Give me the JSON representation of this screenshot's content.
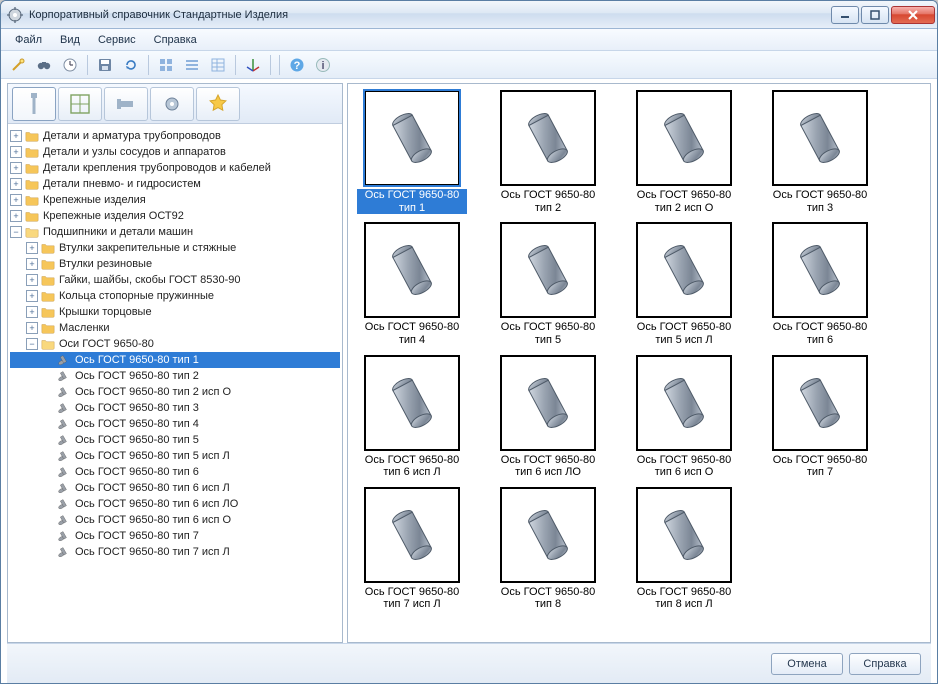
{
  "window": {
    "title": "Корпоративный справочник Стандартные Изделия"
  },
  "menu": {
    "items": [
      "Файл",
      "Вид",
      "Сервис",
      "Справка"
    ]
  },
  "tabs": [
    "bolt",
    "grid",
    "bolt2",
    "gear",
    "star"
  ],
  "tree": {
    "top": [
      "Детали и арматура трубопроводов",
      "Детали и узлы сосудов и аппаратов",
      "Детали крепления трубопроводов и кабелей",
      "Детали пневмо- и гидросистем",
      "Крепежные изделия",
      "Крепежные изделия ОСТ92"
    ],
    "openNode": "Подшипники и детали машин",
    "sub": [
      "Втулки закрепительные и стяжные",
      "Втулки резиновые",
      "Гайки, шайбы, скобы ГОСТ 8530-90",
      "Кольца стопорные пружинные",
      "Крышки торцовые",
      "Масленки"
    ],
    "openLeafFolder": "Оси ГОСТ 9650-80",
    "leaves": [
      "Ось ГОСТ 9650-80 тип 1",
      "Ось ГОСТ 9650-80 тип 2",
      "Ось ГОСТ 9650-80 тип 2 исп О",
      "Ось ГОСТ 9650-80 тип 3",
      "Ось ГОСТ 9650-80 тип 4",
      "Ось ГОСТ 9650-80 тип 5",
      "Ось ГОСТ 9650-80 тип 5 исп Л",
      "Ось ГОСТ 9650-80 тип 6",
      "Ось ГОСТ 9650-80 тип 6 исп Л",
      "Ось ГОСТ 9650-80 тип 6 исп ЛО",
      "Ось ГОСТ 9650-80 тип 6 исп О",
      "Ось ГОСТ 9650-80 тип 7",
      "Ось ГОСТ 9650-80 тип 7 исп Л"
    ],
    "selected": "Ось ГОСТ 9650-80 тип 1"
  },
  "thumbs": [
    "Ось ГОСТ 9650-80 тип 1",
    "Ось ГОСТ 9650-80 тип 2",
    "Ось ГОСТ 9650-80 тип 2 исп О",
    "Ось ГОСТ 9650-80 тип 3",
    "Ось ГОСТ 9650-80 тип 4",
    "Ось ГОСТ 9650-80 тип 5",
    "Ось ГОСТ 9650-80 тип 5 исп Л",
    "Ось ГОСТ 9650-80 тип 6",
    "Ось ГОСТ 9650-80 тип 6 исп Л",
    "Ось ГОСТ 9650-80 тип 6 исп ЛО",
    "Ось ГОСТ 9650-80 тип 6 исп О",
    "Ось ГОСТ 9650-80 тип 7",
    "Ось ГОСТ 9650-80 тип 7 исп Л",
    "Ось ГОСТ 9650-80 тип 8",
    "Ось ГОСТ 9650-80 тип 8 исп Л"
  ],
  "thumb_selected": 0,
  "footer": {
    "cancel": "Отмена",
    "help": "Справка"
  }
}
